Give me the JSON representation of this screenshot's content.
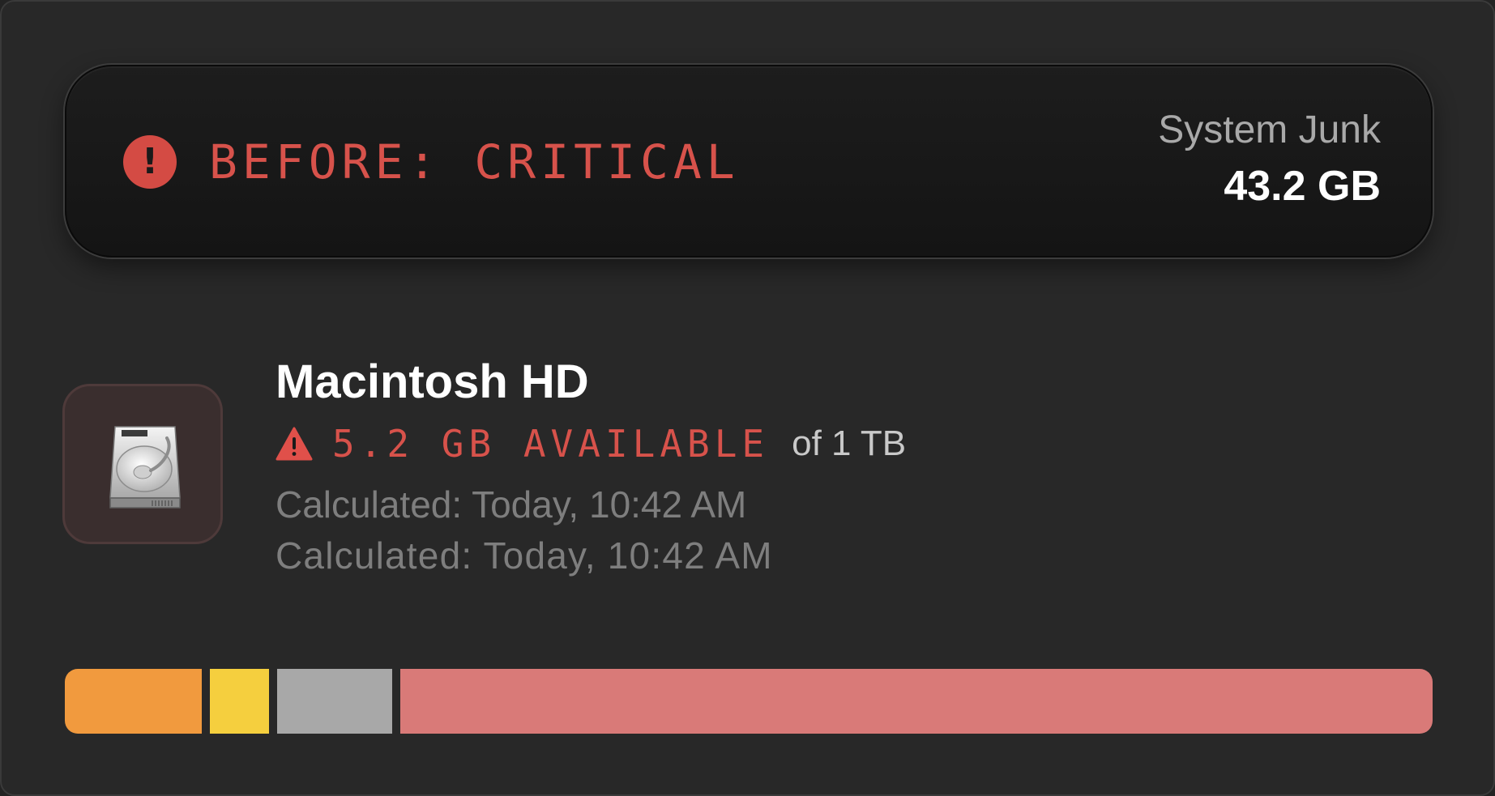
{
  "banner": {
    "status_text": "BEFORE: CRITICAL",
    "status_icon": "exclamation-circle-icon",
    "status_color": "#d7524b",
    "junk_label": "System Junk",
    "junk_value": "43.2 GB"
  },
  "disk": {
    "icon": "hard-drive-icon",
    "name": "Macintosh HD",
    "warning_icon": "warning-triangle-icon",
    "available_text": "5.2 GB AVAILABLE",
    "capacity_text": "of 1 TB",
    "calculated_primary": "Calculated: Today, 10:42 AM",
    "calculated_secondary": "Calculated: Today, 10:42 AM"
  },
  "storage_bar": {
    "segments": [
      {
        "id": "orange",
        "fraction": 0.1,
        "color": "#f19a3e"
      },
      {
        "id": "yellow",
        "fraction": 0.043,
        "color": "#f5cf3e"
      },
      {
        "id": "gray",
        "fraction": 0.084,
        "color": "#a8a8a8"
      },
      {
        "id": "red",
        "fraction": 0.754,
        "color": "#d97a78"
      }
    ]
  }
}
